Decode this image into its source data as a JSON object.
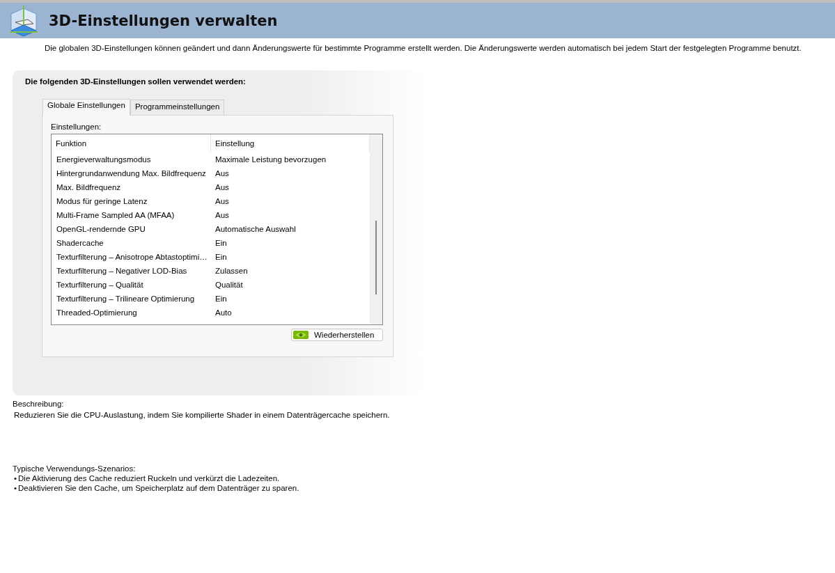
{
  "header": {
    "title": "3D-Einstellungen verwalten",
    "intro": "Die globalen 3D-Einstellungen können geändert und dann Änderungswerte für bestimmte Programme erstellt werden. Die Änderungswerte werden automatisch bei jedem Start der festgelegten Programme benutzt."
  },
  "panel": {
    "heading": "Die folgenden 3D-Einstellungen sollen verwendet werden:",
    "tabs": [
      {
        "label": "Globale Einstellungen",
        "selected": true
      },
      {
        "label": "Programmeinstellungen",
        "selected": false
      }
    ],
    "list_label": "Einstellungen:",
    "columns": [
      "Funktion",
      "Einstellung"
    ],
    "rows": [
      [
        "Energieverwaltungsmodus",
        "Maximale Leistung bevorzugen"
      ],
      [
        "Hintergrundanwendung Max. Bildfrequenz",
        "Aus"
      ],
      [
        "Max. Bildfrequenz",
        "Aus"
      ],
      [
        "Modus für geringe Latenz",
        "Aus"
      ],
      [
        "Multi-Frame Sampled AA (MFAA)",
        "Aus"
      ],
      [
        "OpenGL-rendernde GPU",
        "Automatische Auswahl"
      ],
      [
        "Shadercache",
        "Ein"
      ],
      [
        "Texturfilterung – Anisotrope Abtastoptimi…",
        "Ein"
      ],
      [
        "Texturfilterung – Negativer LOD-Bias",
        "Zulassen"
      ],
      [
        "Texturfilterung – Qualität",
        "Qualität"
      ],
      [
        "Texturfilterung – Trilineare Optimierung",
        "Ein"
      ],
      [
        "Threaded-Optimierung",
        "Auto"
      ]
    ],
    "restore_button": "Wiederherstellen"
  },
  "description": {
    "label": "Beschreibung:",
    "text": "Reduzieren Sie die CPU-Auslastung, indem Sie kompilierte Shader in einem Datenträgercache speichern."
  },
  "scenarios": {
    "label": "Typische Verwendungs-Szenarios:",
    "items": [
      {
        "bullet": "•",
        "text": "Die Aktivierung des Cache reduziert Ruckeln und verkürzt die Ladezeiten."
      },
      {
        "bullet": "•",
        "text": "Deaktivieren Sie den Cache, um Speicherplatz auf dem Datenträger zu sparen."
      }
    ]
  }
}
